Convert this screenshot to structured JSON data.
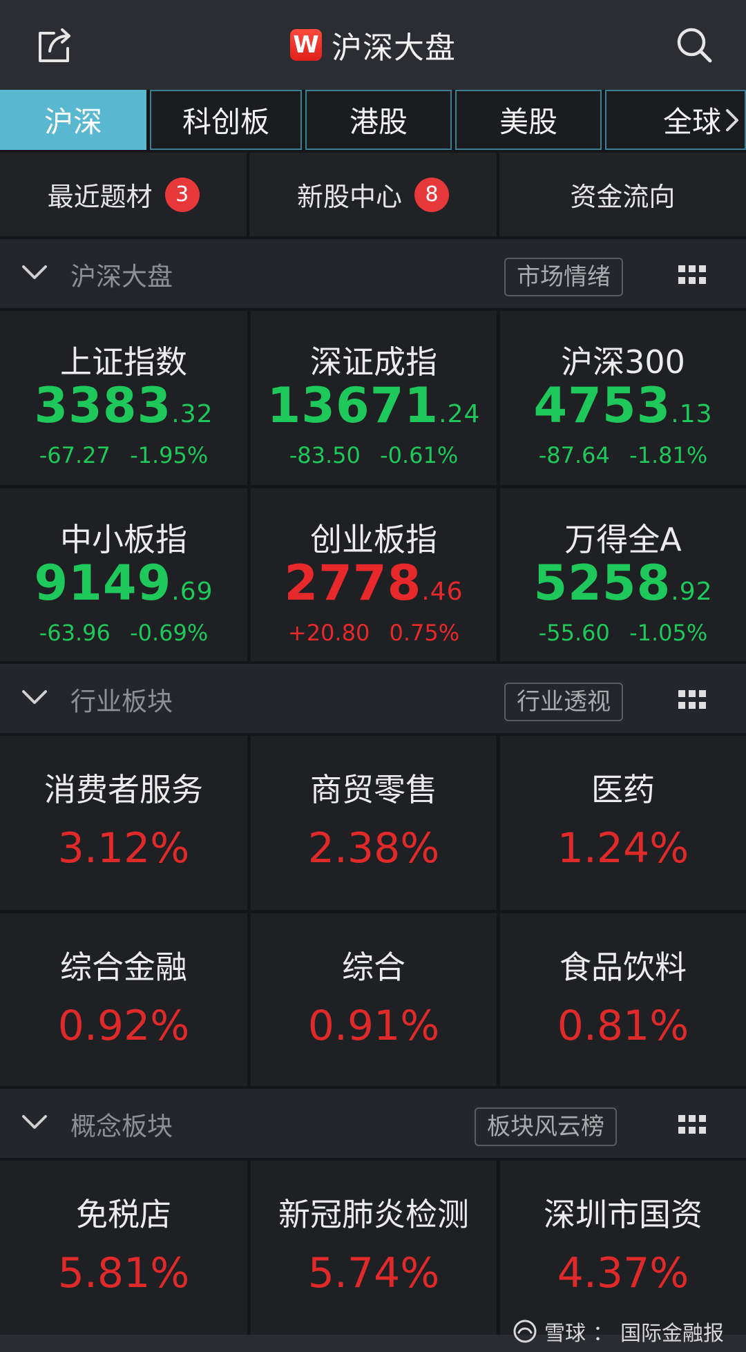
{
  "header": {
    "title": "沪深大盘",
    "logo_letter": "W"
  },
  "tabs": [
    {
      "label": "沪深",
      "active": true
    },
    {
      "label": "科创板",
      "active": false
    },
    {
      "label": "港股",
      "active": false
    },
    {
      "label": "美股",
      "active": false
    },
    {
      "label": "全球",
      "active": false
    }
  ],
  "quick_links": [
    {
      "label": "最近题材",
      "badge": "3"
    },
    {
      "label": "新股中心",
      "badge": "8"
    },
    {
      "label": "资金流向",
      "badge": ""
    }
  ],
  "sections": {
    "indices": {
      "title": "沪深大盘",
      "button": "市场情绪",
      "items": [
        {
          "name": "上证指数",
          "int": "3383",
          "dec": ".32",
          "change": "-67.27",
          "pct": "-1.95%",
          "dir": "down"
        },
        {
          "name": "深证成指",
          "int": "13671",
          "dec": ".24",
          "change": "-83.50",
          "pct": "-0.61%",
          "dir": "down"
        },
        {
          "name": "沪深300",
          "int": "4753",
          "dec": ".13",
          "change": "-87.64",
          "pct": "-1.81%",
          "dir": "down"
        },
        {
          "name": "中小板指",
          "int": "9149",
          "dec": ".69",
          "change": "-63.96",
          "pct": "-0.69%",
          "dir": "down"
        },
        {
          "name": "创业板指",
          "int": "2778",
          "dec": ".46",
          "change": "+20.80",
          "pct": "0.75%",
          "dir": "up"
        },
        {
          "name": "万得全A",
          "int": "5258",
          "dec": ".92",
          "change": "-55.60",
          "pct": "-1.05%",
          "dir": "down"
        }
      ]
    },
    "industry": {
      "title": "行业板块",
      "button": "行业透视",
      "items": [
        {
          "name": "消费者服务",
          "pct": "3.12%"
        },
        {
          "name": "商贸零售",
          "pct": "2.38%"
        },
        {
          "name": "医药",
          "pct": "1.24%"
        },
        {
          "name": "综合金融",
          "pct": "0.92%"
        },
        {
          "name": "综合",
          "pct": "0.91%"
        },
        {
          "name": "食品饮料",
          "pct": "0.81%"
        }
      ]
    },
    "concept": {
      "title": "概念板块",
      "button": "板块风云榜",
      "items": [
        {
          "name": "免税店",
          "pct": "5.81%"
        },
        {
          "name": "新冠肺炎检测",
          "pct": "5.74%"
        },
        {
          "name": "深圳市国资",
          "pct": "4.37%"
        }
      ]
    }
  },
  "watermark": {
    "brand": "雪球",
    "sep": "：",
    "source": "国际金融报"
  },
  "colors": {
    "up": "#e8292b",
    "down": "#1ec85a",
    "active_tab": "#59b7cf",
    "badge": "#e8393a"
  }
}
